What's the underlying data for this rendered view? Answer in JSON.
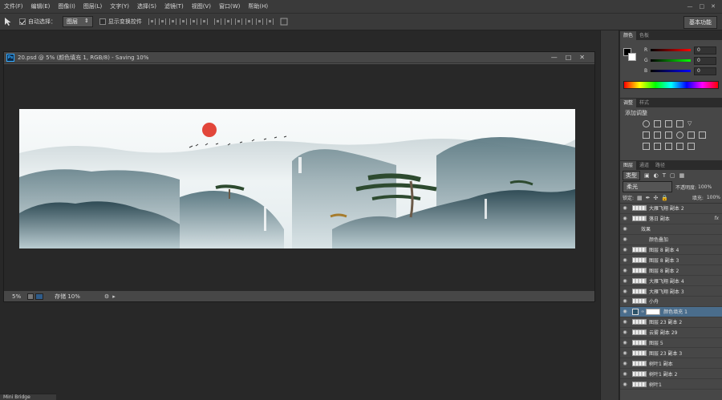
{
  "menu": [
    "文件(F)",
    "编辑(E)",
    "图像(I)",
    "图层(L)",
    "文字(Y)",
    "选择(S)",
    "滤镜(T)",
    "视图(V)",
    "窗口(W)",
    "帮助(H)"
  ],
  "options": {
    "auto_select_label": "自动选择：",
    "auto_select_value": "图层",
    "show_transform_label": "显示变换控件",
    "workspace": "基本功能"
  },
  "document": {
    "title": "20.psd @ 5% (颜色填充 1, RGB/8) - Saving 10%",
    "zoom": "5%",
    "status": "存储 10%"
  },
  "color_panel": {
    "tabs": [
      "颜色",
      "色板"
    ],
    "r_label": "R",
    "r_value": "0",
    "g_label": "G",
    "g_value": "0",
    "b_label": "B",
    "b_value": "0"
  },
  "adjust_panel": {
    "tabs": [
      "调整",
      "样式"
    ],
    "heading": "添加调整"
  },
  "layers_panel": {
    "tabs": [
      "图层",
      "通道",
      "路径"
    ],
    "filter_kind": "类型",
    "blend_mode": "柔光",
    "opacity_label": "不透明度:",
    "opacity_value": "100%",
    "lock_label": "锁定:",
    "fill_label": "填充:",
    "fill_value": "100%",
    "layers": [
      {
        "name": "大雁飞翔 副本 2"
      },
      {
        "name": "落日 副本",
        "fx": "fx"
      },
      {
        "name": "效果"
      },
      {
        "name": "颜色叠加"
      },
      {
        "name": "图层 8 副本 4"
      },
      {
        "name": "图层 8 副本 3"
      },
      {
        "name": "图层 8 副本 2"
      },
      {
        "name": "大雁飞翔 副本 4"
      },
      {
        "name": "大雁飞翔 副本 3"
      },
      {
        "name": "小舟"
      },
      {
        "name": "颜色填充 1",
        "selected": true
      },
      {
        "name": "图层 23 副本 2"
      },
      {
        "name": "云雾 副本 29"
      },
      {
        "name": "图层 5"
      },
      {
        "name": "图层 23 副本 3"
      },
      {
        "name": "树叶1 副本"
      },
      {
        "name": "树叶1 副本 2"
      },
      {
        "name": "树叶1"
      }
    ]
  },
  "mini_bridge": "Mini Bridge"
}
